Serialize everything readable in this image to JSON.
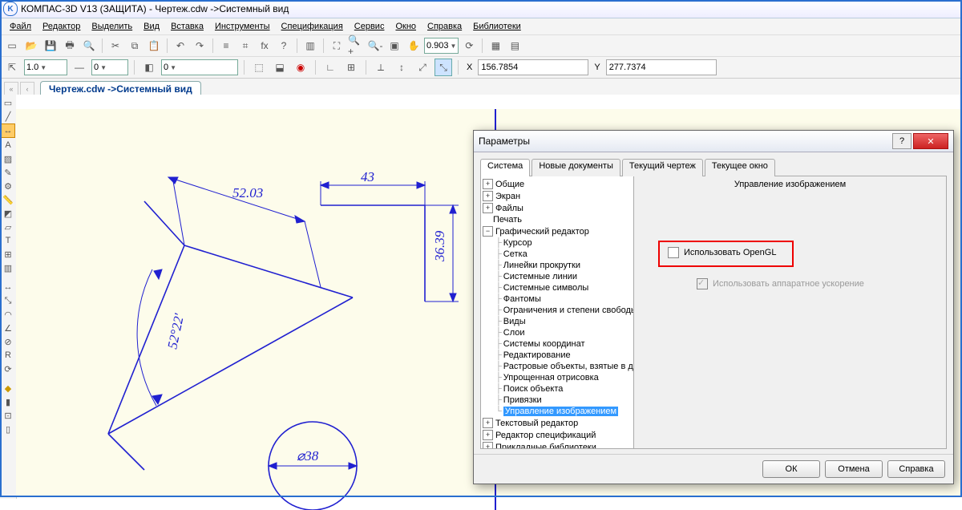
{
  "app": {
    "title": "КОМПАС-3D V13 (ЗАЩИТА) - Чертеж.cdw ->Системный вид"
  },
  "menu": {
    "file": "Файл",
    "edit": "Редактор",
    "select": "Выделить",
    "view": "Вид",
    "insert": "Вставка",
    "tools": "Инструменты",
    "spec": "Спецификация",
    "service": "Сервис",
    "window": "Окно",
    "help": "Справка",
    "libs": "Библиотеки"
  },
  "toolbar": {
    "scale_combo": "0.903",
    "line_weight": "1.0",
    "style_combo": "0",
    "layer_combo": "0",
    "coord_x_label": "X",
    "coord_x": "156.7854",
    "coord_y_label": "Y",
    "coord_y": "277.7374"
  },
  "tabs": {
    "doc": "Чертеж.cdw ->Системный вид"
  },
  "drawing": {
    "dim1": "52.03",
    "dim2": "43",
    "dim3": "36.39",
    "angle": "52°22'",
    "dia": "⌀38"
  },
  "dialog": {
    "title": "Параметры",
    "tabs": {
      "system": "Система",
      "newdocs": "Новые документы",
      "curdwg": "Текущий чертеж",
      "curwin": "Текущее окно"
    },
    "tree": {
      "common": "Общие",
      "screen": "Экран",
      "files": "Файлы",
      "print": "Печать",
      "gfx": "Графический редактор",
      "cursor": "Курсор",
      "grid": "Сетка",
      "scrollbars": "Линейки прокрутки",
      "syslines": "Системные линии",
      "syssymbols": "Системные символы",
      "phantoms": "Фантомы",
      "constraints": "Ограничения и степени свободы",
      "views": "Виды",
      "layers": "Слои",
      "coordsys": "Системы координат",
      "editing": "Редактирование",
      "raster": "Растровые объекты, взятые в документ",
      "simpledraw": "Упрощенная отрисовка",
      "objsearch": "Поиск объекта",
      "snaps": "Привязки",
      "imgmgmt": "Управление изображением",
      "txted": "Текстовый редактор",
      "speced": "Редактор спецификаций",
      "applibs": "Прикладные библиотеки"
    },
    "panel": {
      "heading": "Управление изображением",
      "use_opengl": "Использовать OpenGL",
      "hw_accel": "Использовать аппаратное ускорение"
    },
    "buttons": {
      "ok": "ОК",
      "cancel": "Отмена",
      "help": "Справка"
    }
  }
}
